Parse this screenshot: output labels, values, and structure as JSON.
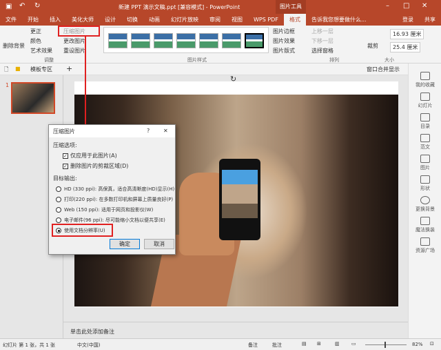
{
  "titlebar": {
    "title": "新建 PPT 演示文稿.ppt [兼容模式] - PowerPoint",
    "context_tab": "图片工具"
  },
  "tabs": [
    "文件",
    "开始",
    "插入",
    "美化大师",
    "设计",
    "切换",
    "动画",
    "幻灯片放映",
    "审阅",
    "视图",
    "WPS PDF",
    "格式"
  ],
  "tell_me": "告诉我您想要做什么...",
  "login": "登录",
  "share": "共享",
  "ribbon": {
    "remove_bg": "删除背景",
    "corrections": "更正",
    "color": "颜色",
    "artistic": "艺术效果",
    "compress": "压缩图片",
    "change": "更改图片",
    "reset": "重设图片",
    "group_adjust": "调整",
    "group_styles": "图片样式",
    "border": "图片边框",
    "effects": "图片效果",
    "layout": "图片版式",
    "bring_forward": "上移一层",
    "send_backward": "下移一层",
    "selection_pane": "选择窗格",
    "group_arrange": "排列",
    "crop": "裁剪",
    "height": "16.93 厘米",
    "width": "25.4 厘米",
    "group_size": "大小"
  },
  "tabrow": {
    "template_zone": "模板专区",
    "merge_windows": "窗口合并显示"
  },
  "slide_number": "1",
  "dialog": {
    "title": "压缩图片",
    "help": "?",
    "close": "✕",
    "options_label": "压缩选项:",
    "opt1": "仅应用于此图片(A)",
    "opt2": "删除图片的剪裁区域(D)",
    "target_label": "目标输出:",
    "r1": "HD (330 ppi): 高保真，适合高清晰度(HD)显示(H)",
    "r2": "打印(220 ppi): 在多数打印机和屏幕上质量良好(P)",
    "r3": "Web (150 ppi): 适用于网页和投影仪(W)",
    "r4": "电子邮件(96 ppi): 尽可能缩小文档以便共享(E)",
    "r5": "使用文档分辨率(U)",
    "ok": "确定",
    "cancel": "取消"
  },
  "right_sidebar": [
    "我的收藏",
    "幻灯片",
    "目录",
    "范文",
    "图片",
    "形状",
    "更换背景",
    "魔法换装",
    "资源广场"
  ],
  "notes_placeholder": "单击此处添加备注",
  "status": {
    "slide_info": "幻灯片 第 1 张，共 1 张",
    "language": "中文(中国)",
    "notes": "备注",
    "comments": "批注",
    "zoom": "82%"
  },
  "colors": {
    "accent": "#b7472a",
    "highlight": "#e02020"
  }
}
